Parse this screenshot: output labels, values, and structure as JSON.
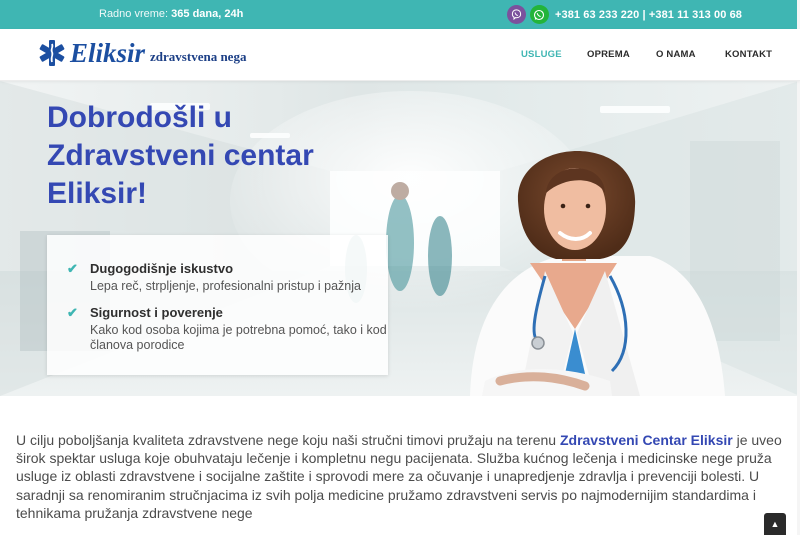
{
  "topbar": {
    "hours_label": "Radno vreme:",
    "hours_value": "365 dana, 24h",
    "viber_icon": "viber-icon",
    "whatsapp_icon": "whatsapp-icon",
    "phones": "+381 63 233 220 | +381 11 313 00 68"
  },
  "header": {
    "logo_name": "Eliksir",
    "logo_tagline": "zdravstvena nega",
    "logo_icon": "star-of-life-icon",
    "nav": [
      {
        "label": "USLUGE",
        "active": true
      },
      {
        "label": "OPREMA",
        "active": false
      },
      {
        "label": "O NAMA",
        "active": false
      },
      {
        "label": "KONTAKT",
        "active": false
      }
    ]
  },
  "hero": {
    "title": "Dobrodošli u Zdravstveni centar Eliksir!",
    "features": [
      {
        "title": "Dugogodišnje iskustvo",
        "text": "Lepa reč, strpljenje, profesionalni pristup i pažnja"
      },
      {
        "title": "Sigurnost i poverenje",
        "text": "Kako kod osoba kojima je potrebna pomoć, tako i kod članova porodice"
      }
    ]
  },
  "intro": {
    "before": "U cilju poboljšanja kvaliteta zdravstvene nege koju naši stručni timovi pružaju na terenu ",
    "brand": "Zdravstveni Centar Eliksir",
    "after": " je uveo širok spektar usluga koje obuhvataju lečenje i kompletnu negu pacijenata. Služba kućnog lečenja i medicinske nege pruža usluge iz oblasti zdravstvene i socijalne zaštite i sprovodi mere za očuvanje i unapredjenje zdravlja i prevenciji bolesti. U saradnji sa renomiranim stručnjacima iz svih polja medicine pružamo zdravstveni servis po najmodernijim standardima i tehnikama pružanja zdravstvene nege"
  },
  "colors": {
    "accent": "#3fb6b3",
    "brand_blue": "#3448b3",
    "logo_blue": "#1c4fa1"
  },
  "scroll_top_icon": "chevron-up-icon"
}
